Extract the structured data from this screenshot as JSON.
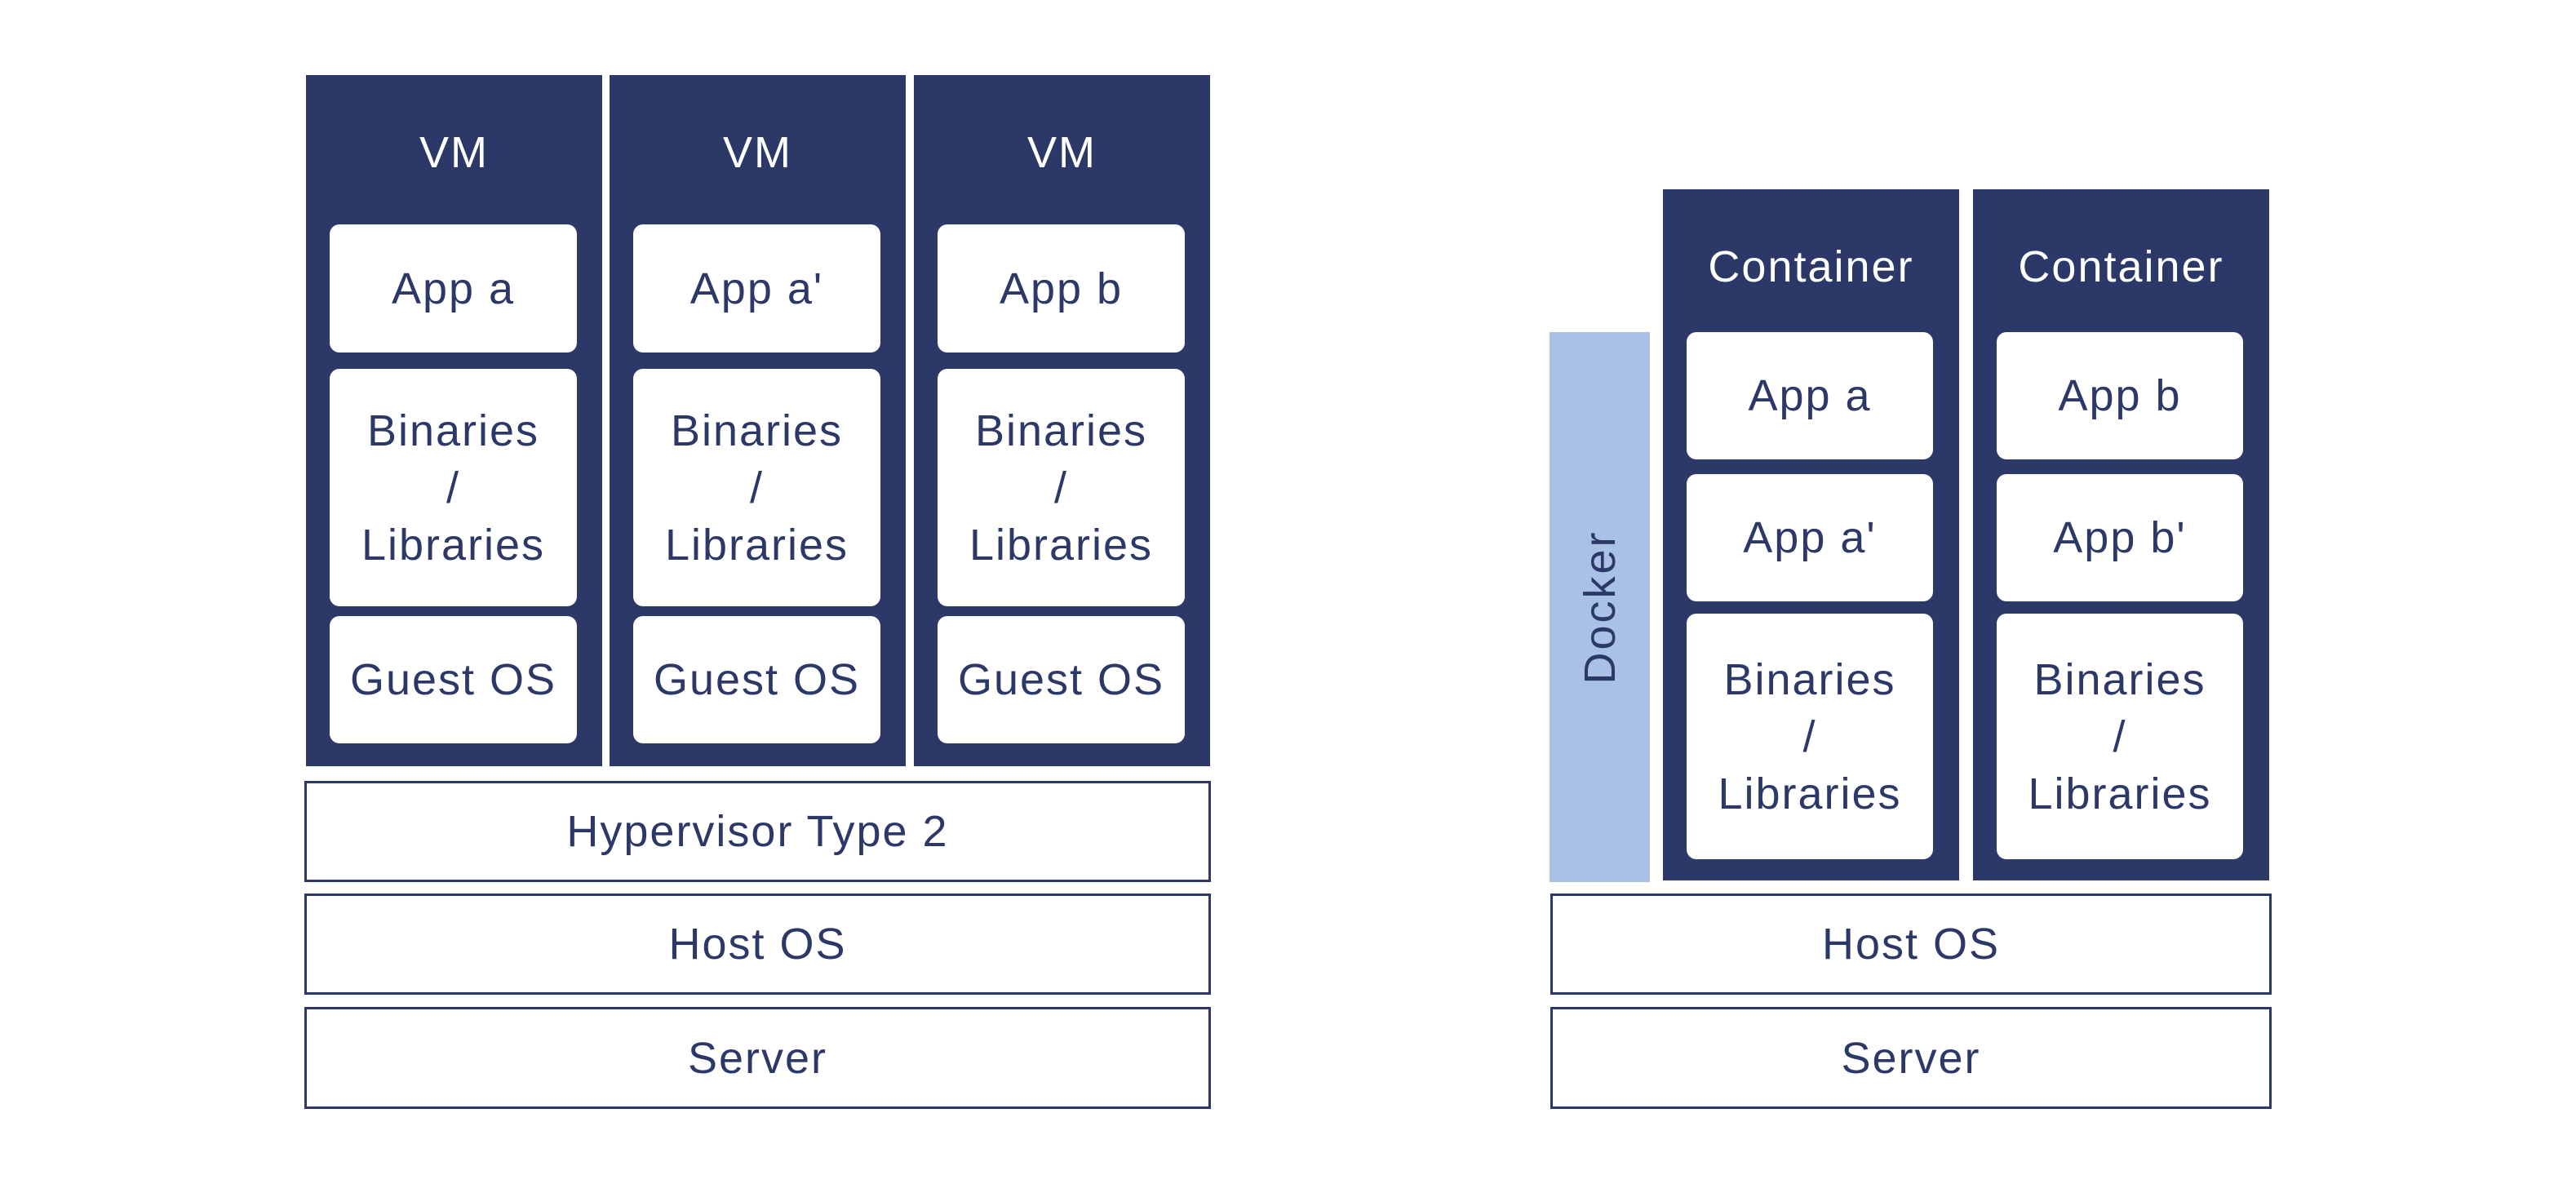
{
  "colors": {
    "navy": "#2c3968",
    "docker_blue": "#a8c1e5",
    "box_fill": "#ffffff"
  },
  "vm_stack": {
    "vms": [
      {
        "title": "VM",
        "app": "App a",
        "bin_lines": [
          "Binaries",
          "/",
          "Libraries"
        ],
        "guest_os": "Guest OS"
      },
      {
        "title": "VM",
        "app": "App a'",
        "bin_lines": [
          "Binaries",
          "/",
          "Libraries"
        ],
        "guest_os": "Guest OS"
      },
      {
        "title": "VM",
        "app": "App b",
        "bin_lines": [
          "Binaries",
          "/",
          "Libraries"
        ],
        "guest_os": "Guest OS"
      }
    ],
    "hypervisor": "Hypervisor Type 2",
    "host_os": "Host OS",
    "server": "Server"
  },
  "container_stack": {
    "docker_label": "Docker",
    "containers": [
      {
        "title": "Container",
        "app_top": "App a",
        "app_bottom": "App a'",
        "bin_lines": [
          "Binaries",
          "/",
          "Libraries"
        ]
      },
      {
        "title": "Container",
        "app_top": "App b",
        "app_bottom": "App b'",
        "bin_lines": [
          "Binaries",
          "/",
          "Libraries"
        ]
      }
    ],
    "host_os": "Host OS",
    "server": "Server"
  }
}
